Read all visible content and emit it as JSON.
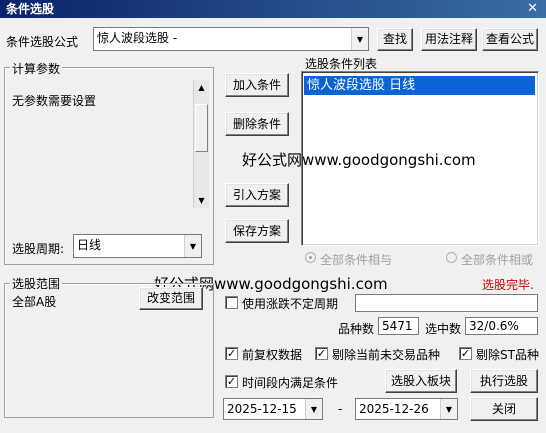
{
  "window": {
    "title": "条件选股",
    "close_glyph": "✕"
  },
  "formula": {
    "label": "条件选股公式",
    "selected": "惊人波段选股 -",
    "find_button": "查找",
    "usage_button": "用法注释",
    "view_button": "查看公式"
  },
  "params": {
    "group_label": "计算参数",
    "message": "无参数需要设置",
    "period_label": "选股周期:",
    "period_value": "日线"
  },
  "actions": {
    "add_condition": "加入条件",
    "delete_condition": "删除条件",
    "import_scheme": "引入方案",
    "save_scheme": "保存方案"
  },
  "condition_list": {
    "label": "选股条件列表",
    "items": [
      "惊人波段选股  日线"
    ]
  },
  "logic": {
    "and_label": "全部条件相与",
    "or_label": "全部条件相或"
  },
  "status": {
    "text": "选股完毕.",
    "color": "#cc0000"
  },
  "watermarks": [
    "好公式网www.goodgongshi.com",
    "好公式网www.goodgongshi.com"
  ],
  "range": {
    "group_label": "选股范围",
    "value": "全部A股",
    "change_button": "改变范围"
  },
  "options": {
    "irregular_period_label": "使用涨跌不定周期",
    "irregular_period_checked": false,
    "forward_adjust_label": "前复权数据",
    "forward_adjust_checked": true,
    "exclude_untraded_label": "剔除当前未交易品种",
    "exclude_untraded_checked": true,
    "exclude_st_label": "剔除ST品种",
    "exclude_st_checked": true,
    "time_range_label": "时间段内满足条件",
    "time_range_checked": true
  },
  "stats": {
    "count_label": "品种数",
    "count_value": "5471",
    "selected_label": "选中数",
    "selected_value": "32/0.6%"
  },
  "dates": {
    "start": "2025-12-15",
    "separator": "-",
    "end": "2025-12-26"
  },
  "bottom_buttons": {
    "to_block": "选股入板块",
    "execute": "执行选股",
    "close": "关闭"
  },
  "colors": {
    "titlebar": "#0a246a",
    "selection": "#0a64d6",
    "status": "#cc0000"
  }
}
